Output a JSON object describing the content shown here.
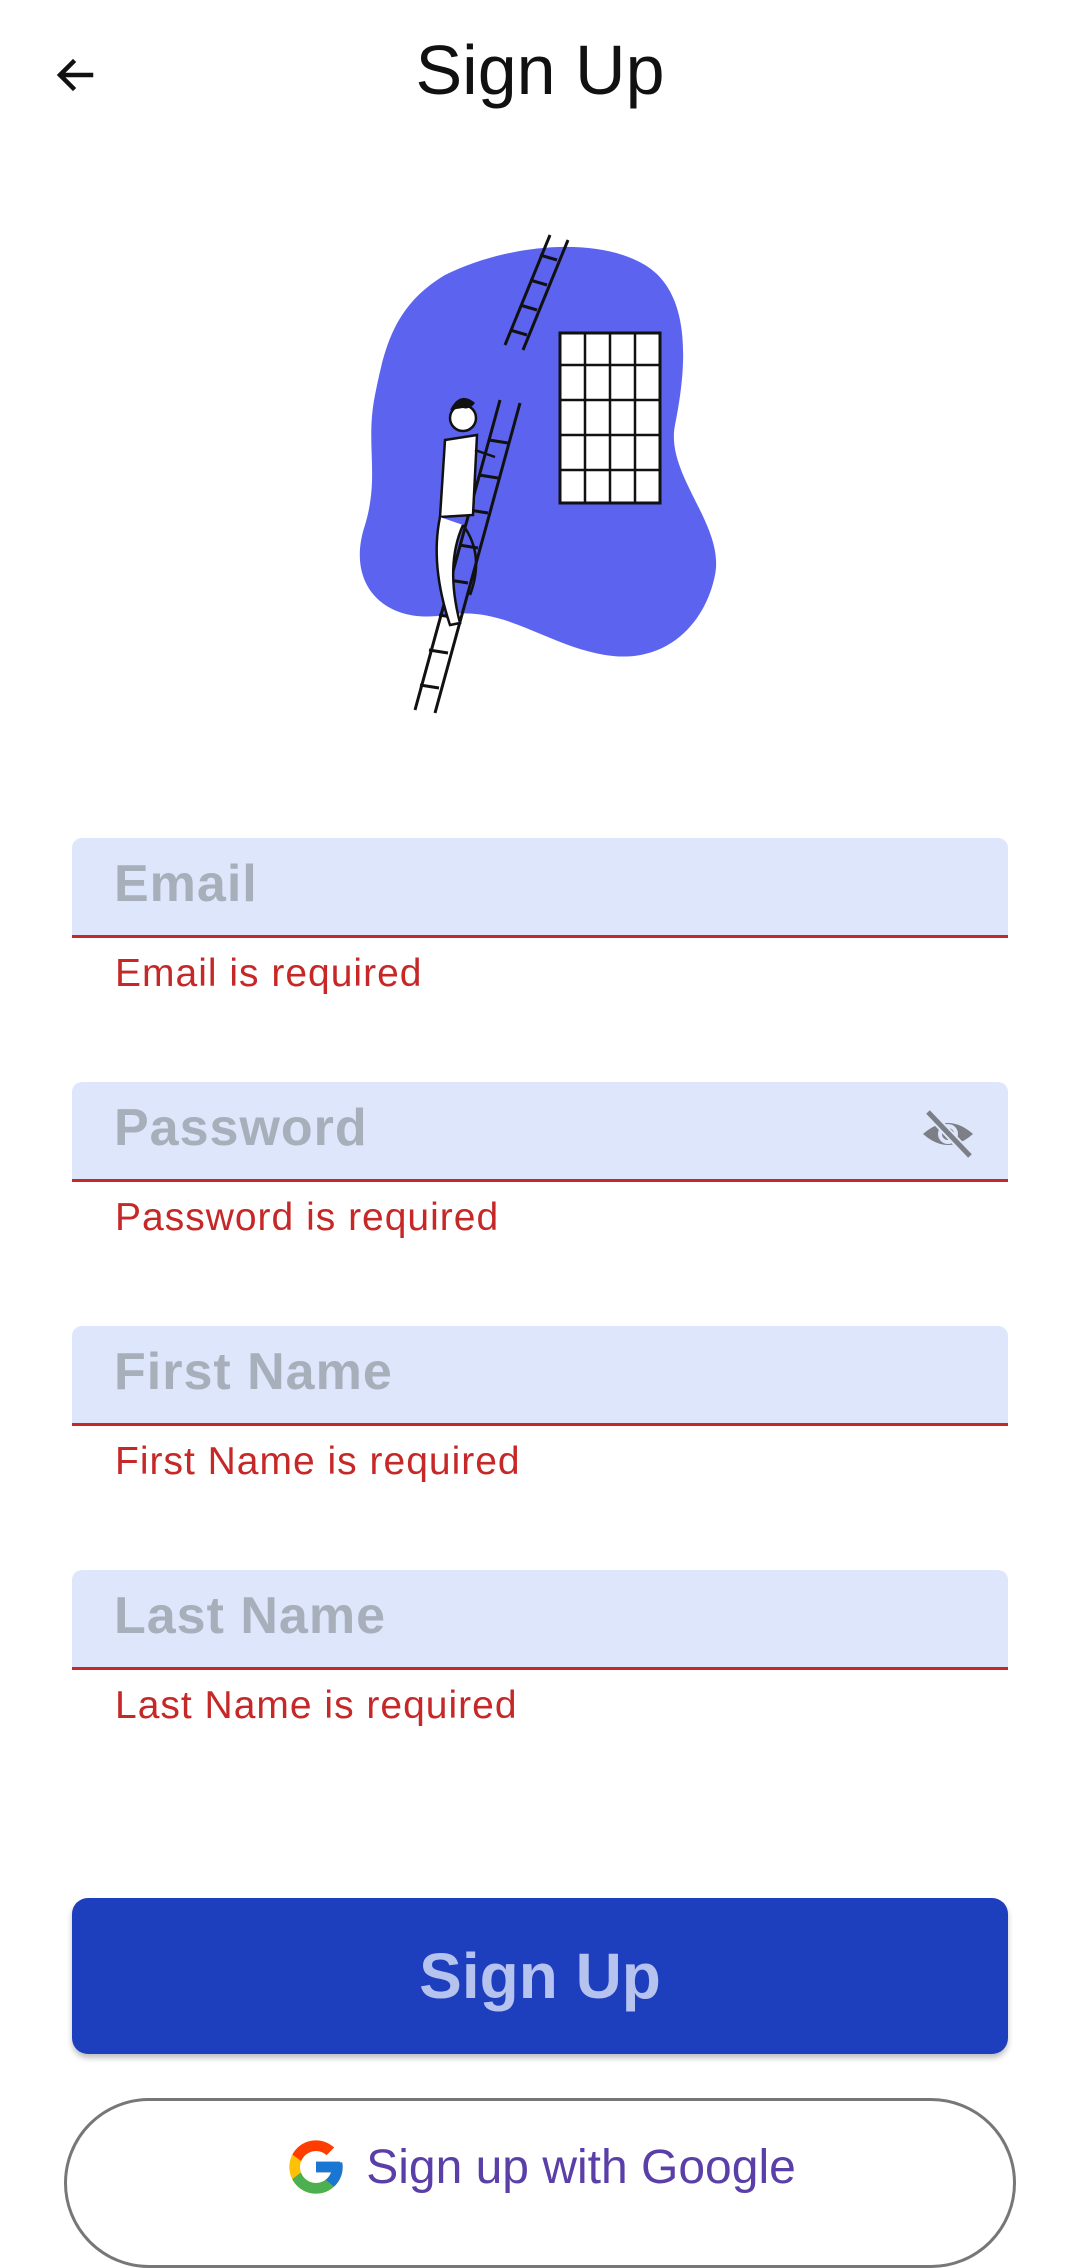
{
  "appbar": {
    "title": "Sign Up",
    "back_icon": "arrow-left-icon"
  },
  "form": {
    "email": {
      "placeholder": "Email",
      "error": "Email is required"
    },
    "password": {
      "placeholder": "Password",
      "error": "Password is required",
      "toggle_icon": "eye-off-icon"
    },
    "first_name": {
      "placeholder": "First Name",
      "error": "First Name is required"
    },
    "last_name": {
      "placeholder": "Last Name",
      "error": "Last Name is required"
    }
  },
  "actions": {
    "signup_label": "Sign Up",
    "google_label": "Sign up with Google",
    "google_icon": "google-icon"
  },
  "colors": {
    "primary": "#1e3fbd",
    "field_fill": "#dde6fb",
    "error": "#c62828",
    "illustration_blob": "#5c63ef"
  }
}
